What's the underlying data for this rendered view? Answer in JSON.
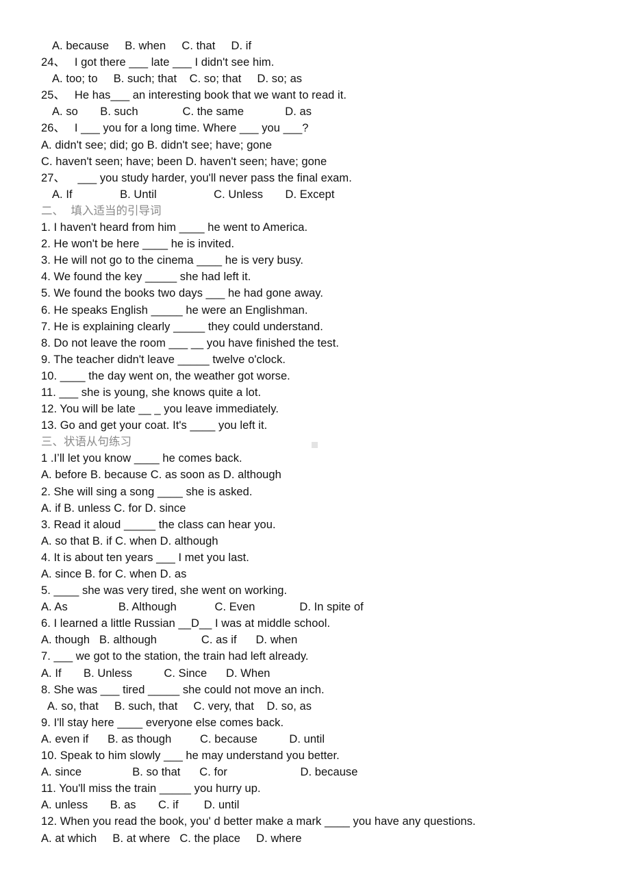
{
  "document": {
    "type": "worksheet",
    "language": "English grammar exercise with Chinese section headings",
    "lines": [
      {
        "id": "l1",
        "text": "A. because     B. when     C. that     D. if",
        "indent": "indent",
        "style": "body"
      },
      {
        "id": "l2",
        "text": "24、   I got there ___ late ___ I didn't see him.",
        "indent": "none",
        "style": "body"
      },
      {
        "id": "l3",
        "text": "A. too; to     B. such; that    C. so; that     D. so; as",
        "indent": "indent",
        "style": "body"
      },
      {
        "id": "l4",
        "text": "25、   He has___ an interesting book that we want to read it.",
        "indent": "none",
        "style": "body"
      },
      {
        "id": "l5",
        "text": "A. so       B. such              C. the same             D. as",
        "indent": "indent",
        "style": "body"
      },
      {
        "id": "l6",
        "text": "26、   I ___ you for a long time. Where ___ you ___?",
        "indent": "none",
        "style": "body"
      },
      {
        "id": "l7",
        "text": "A. didn't see; did; go B. didn't see; have; gone",
        "indent": "none",
        "style": "body"
      },
      {
        "id": "l8",
        "text": "C. haven't seen; have; been D. haven't seen; have; gone",
        "indent": "none",
        "style": "body"
      },
      {
        "id": "l9",
        "text": "27、    ___ you study harder, you'll never pass the final exam.",
        "indent": "none",
        "style": "body"
      },
      {
        "id": "l10",
        "text": "A. If               B. Until                  C. Unless       D. Except",
        "indent": "indent",
        "style": "body"
      },
      {
        "id": "l11",
        "text": "二、  填入适当的引导词",
        "indent": "none",
        "style": "heading-cn"
      },
      {
        "id": "l12",
        "text": "1. I haven't heard from him ____ he went to America.",
        "indent": "none",
        "style": "body"
      },
      {
        "id": "l13",
        "text": "2. He won't be here ____ he is invited.",
        "indent": "none",
        "style": "body"
      },
      {
        "id": "l14",
        "text": "3. He will not go to the cinema ____ he is very busy.",
        "indent": "none",
        "style": "body"
      },
      {
        "id": "l15",
        "text": "4. We found the key _____ she had left it.",
        "indent": "none",
        "style": "body"
      },
      {
        "id": "l16",
        "text": "5. We found the books two days ___ he had gone away.",
        "indent": "none",
        "style": "body"
      },
      {
        "id": "l17",
        "text": "6. He speaks English _____ he were an Englishman.",
        "indent": "none",
        "style": "body"
      },
      {
        "id": "l18",
        "text": "7. He is explaining clearly _____ they could understand.",
        "indent": "none",
        "style": "body"
      },
      {
        "id": "l19",
        "text": "8. Do not leave the room ___ __ you have finished the test.",
        "indent": "none",
        "style": "body"
      },
      {
        "id": "l20",
        "text": "9. The teacher didn't leave _____ twelve o'clock.",
        "indent": "none",
        "style": "body"
      },
      {
        "id": "l21",
        "text": "10. ____ the day went on, the weather got worse.",
        "indent": "none",
        "style": "body"
      },
      {
        "id": "l22",
        "text": "11. ___ she is young, she knows quite a lot.",
        "indent": "none",
        "style": "body"
      },
      {
        "id": "l23",
        "text": "12. You will be late __ _ you leave immediately.",
        "indent": "none",
        "style": "body"
      },
      {
        "id": "l24",
        "text": "13. Go and get your coat. It's ____ you left it.",
        "indent": "none",
        "style": "body"
      },
      {
        "id": "l25",
        "text": "三、状语从句练习",
        "indent": "none",
        "style": "heading-cn"
      },
      {
        "id": "l26",
        "text": "1 .I’ll let you know ____ he comes back.",
        "indent": "none",
        "style": "body"
      },
      {
        "id": "l27",
        "text": "A. before B. because C. as soon as D. although",
        "indent": "none",
        "style": "body"
      },
      {
        "id": "l28",
        "text": "2. She will sing a song ____ she is asked.",
        "indent": "none",
        "style": "body"
      },
      {
        "id": "l29",
        "text": "A. if B. unless C. for D. since",
        "indent": "none",
        "style": "body"
      },
      {
        "id": "l30",
        "text": "3. Read it aloud _____ the class can hear you.",
        "indent": "none",
        "style": "body"
      },
      {
        "id": "l31",
        "text": "A. so that B. if C. when D. although",
        "indent": "none",
        "style": "body"
      },
      {
        "id": "l32",
        "text": "4. It is about ten years ___ I met you last.",
        "indent": "none",
        "style": "body"
      },
      {
        "id": "l33",
        "text": "A. since B. for C. when D. as",
        "indent": "none",
        "style": "body"
      },
      {
        "id": "l34",
        "text": "5. ____ she was very tired, she went on working.",
        "indent": "none",
        "style": "body"
      },
      {
        "id": "l35",
        "text": "A. As                B. Although            C. Even              D. In spite of",
        "indent": "none",
        "style": "body"
      },
      {
        "id": "l36",
        "text": "6. I learned a little Russian __D__ I was at middle school.",
        "indent": "none",
        "style": "body"
      },
      {
        "id": "l37",
        "text": "A. though   B. although              C. as if      D. when",
        "indent": "none",
        "style": "body"
      },
      {
        "id": "l38",
        "text": "7. ___ we got to the station, the train had left already.",
        "indent": "none",
        "style": "body"
      },
      {
        "id": "l39",
        "text": "A. If       B. Unless          C. Since      D. When",
        "indent": "none",
        "style": "body"
      },
      {
        "id": "l40",
        "text": "8. She was ___ tired _____ she could not move an inch.",
        "indent": "none",
        "style": "body"
      },
      {
        "id": "l41",
        "text": "A. so, that     B. such, that     C. very, that    D. so, as",
        "indent": "indent-sm",
        "style": "body"
      },
      {
        "id": "l42",
        "text": "9. I'll stay here ____ everyone else comes back.",
        "indent": "none",
        "style": "body"
      },
      {
        "id": "l43",
        "text": "A. even if      B. as though         C. because          D. until",
        "indent": "none",
        "style": "body"
      },
      {
        "id": "l44",
        "text": "10. Speak to him slowly ___ he may understand you better.",
        "indent": "none",
        "style": "body"
      },
      {
        "id": "l45",
        "text": "A. since                B. so that      C. for                       D. because",
        "indent": "none",
        "style": "body"
      },
      {
        "id": "l46",
        "text": "11. You'll miss the train _____ you hurry up.",
        "indent": "none",
        "style": "body"
      },
      {
        "id": "l47",
        "text": "A. unless       B. as       C. if        D. until",
        "indent": "none",
        "style": "body"
      },
      {
        "id": "l48",
        "text": "12. When you read the book, you' d better make a mark ____ you have any questions.",
        "indent": "none",
        "style": "body"
      },
      {
        "id": "l49",
        "text": "A. at which     B. at where   C. the place     D. where",
        "indent": "none",
        "style": "body"
      }
    ],
    "colors": {
      "body_text": "#111111",
      "heading_text": "#8a8a8a",
      "page_background": "#ffffff",
      "artifact": "#e3e3e3"
    }
  }
}
